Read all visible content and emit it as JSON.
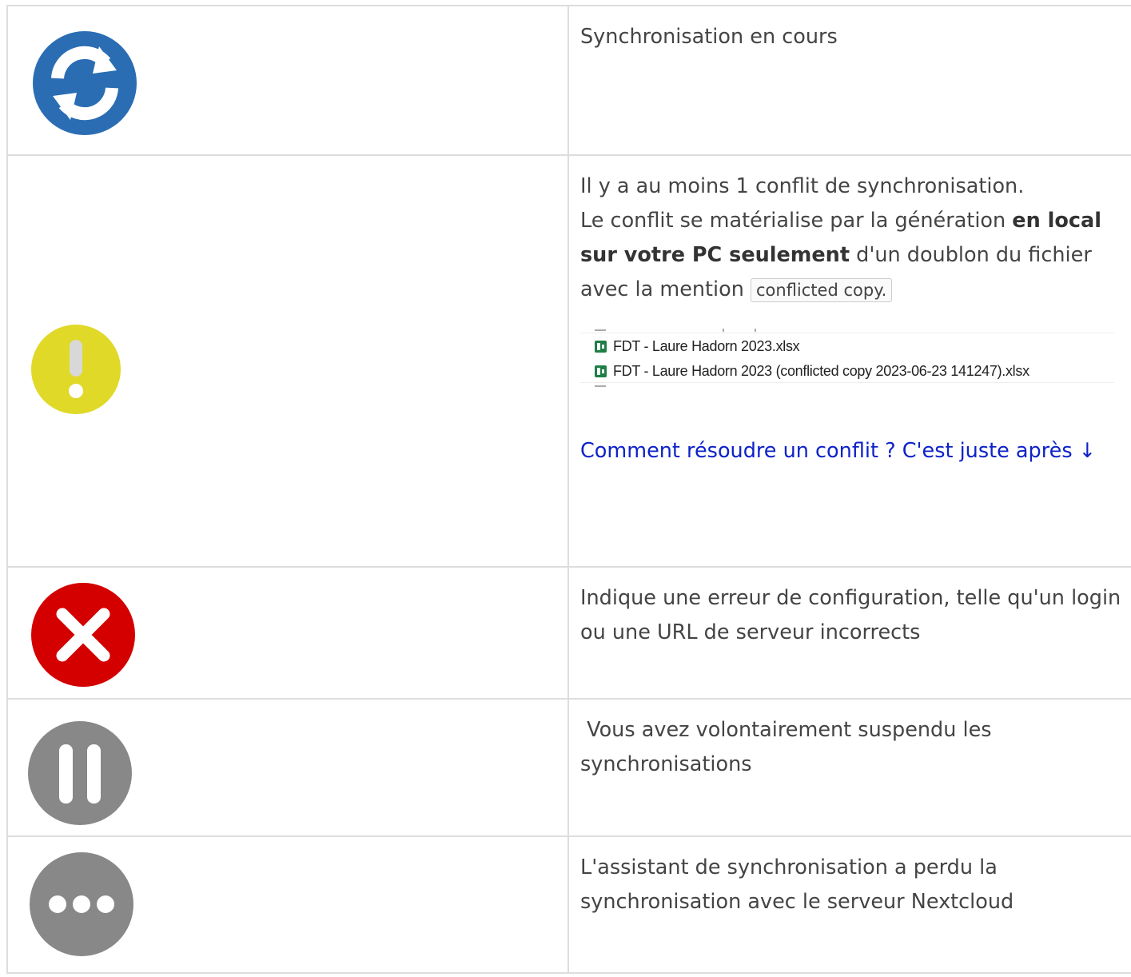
{
  "rows": [
    {
      "icon": "sync-icon",
      "icon_color": "#2a6db3",
      "text": "Synchronisation en cours"
    },
    {
      "icon": "warning-icon",
      "icon_color": "#e0d928",
      "line1": "Il y a au moins 1 conflit de synchronisation.",
      "line2_pre": "Le conflit se matérialise par la génération ",
      "line2_bold": "en local sur votre PC seulement",
      "line2_post": " d'un doublon du fichier avec la mention ",
      "code": "conflicted copy.",
      "files": [
        "FDT - Laure Hadorn 2023.xlsx",
        "FDT - Laure Hadorn 2023 (conflicted copy 2023-06-23 141247).xlsx"
      ],
      "link": "Comment résoudre un conflit ? C'est juste après ↓"
    },
    {
      "icon": "error-icon",
      "icon_color": "#d40000",
      "text": "Indique une erreur de configuration, telle qu'un login ou une URL de serveur incorrects"
    },
    {
      "icon": "pause-icon",
      "icon_color": "#888888",
      "text": " Vous avez volontairement suspendu les synchronisations"
    },
    {
      "icon": "ellipsis-icon",
      "icon_color": "#888888",
      "text": "L'assistant de synchronisation a perdu la synchronisation avec le serveur Nextcloud"
    }
  ]
}
